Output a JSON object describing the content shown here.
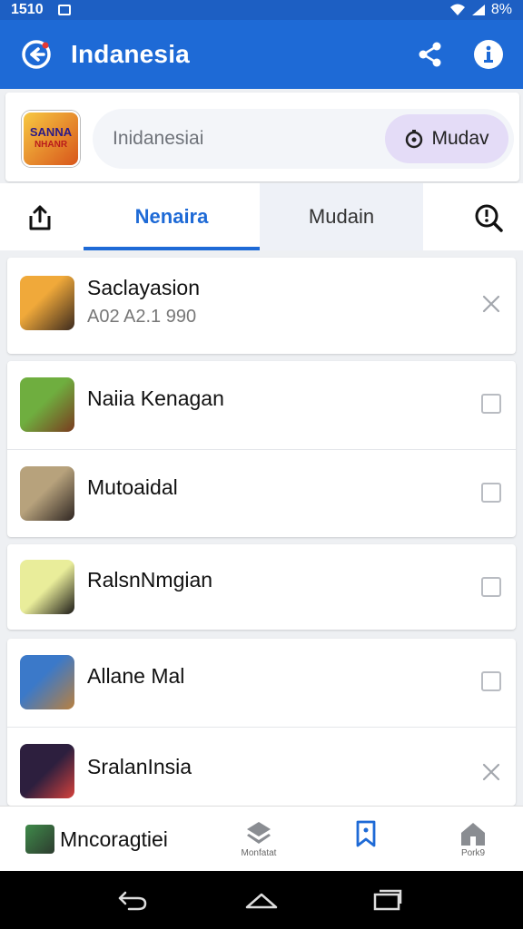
{
  "status_bar": {
    "left_text": "1510",
    "battery": "8%"
  },
  "app_bar": {
    "title": "Indanesia"
  },
  "search": {
    "placeholder": "Inidanesiai",
    "pill_label": "Mudav",
    "app_icon_text": "SANNA",
    "app_icon_subtext": "NHANR"
  },
  "tabs": {
    "active_label": "Nenaira",
    "inactive_label": "Mudain"
  },
  "list": [
    {
      "name": "Saclayasion",
      "subtitle": "A02 A2.1 990",
      "control": "close",
      "colors": [
        "#f0a93a",
        "#3c2a1e"
      ]
    },
    {
      "name": "Naiia Kenagan",
      "subtitle": "",
      "control": "checkbox",
      "colors": [
        "#6fae3f",
        "#7a3b1f"
      ]
    },
    {
      "name": "Mutoaidal",
      "subtitle": "",
      "control": "checkbox",
      "colors": [
        "#b7a27c",
        "#2f2622"
      ]
    },
    {
      "name": "RalsnNmgian",
      "subtitle": "",
      "control": "checkbox",
      "colors": [
        "#e9ed9a",
        "#1c1a17"
      ]
    },
    {
      "name": "Allane Mal",
      "subtitle": "",
      "control": "checkbox",
      "colors": [
        "#3b79c9",
        "#b9803f"
      ]
    },
    {
      "name": "SralanInsia",
      "subtitle": "",
      "control": "close",
      "colors": [
        "#2d1f3e",
        "#d6413c"
      ]
    }
  ],
  "bottom_nav": {
    "profile_label": "Mncoragtiei",
    "items": [
      {
        "label": "Monfatat",
        "icon": "layers-icon"
      },
      {
        "label": "",
        "icon": "bookmark-icon"
      },
      {
        "label": "Pork9",
        "icon": "home-icon"
      }
    ]
  },
  "colors": {
    "primary": "#1e6ad6",
    "pill": "#e4dcf7"
  }
}
